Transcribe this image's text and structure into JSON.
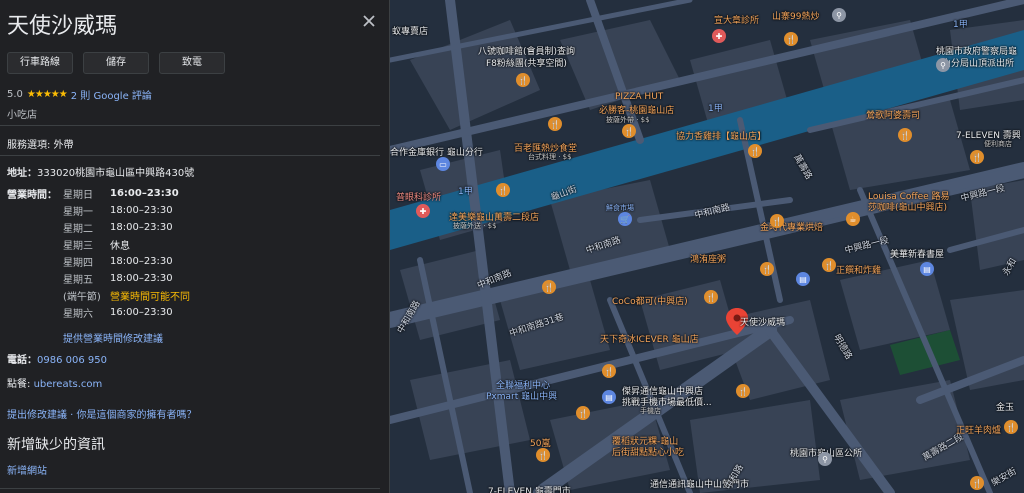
{
  "panel": {
    "title": "天使沙威瑪",
    "buttons": {
      "directions": "行車路線",
      "save": "儲存",
      "call": "致電"
    },
    "rating": {
      "score": "5.0",
      "stars": "★★★★★",
      "reviews": "2 則 Google 評論"
    },
    "category": "小吃店",
    "service_options": "服務選項: 外帶",
    "address_label": "地址：",
    "address": "333020桃園市龜山區中興路430號",
    "hours_label": "營業時間：",
    "hours": [
      {
        "day": "星期日",
        "time": "16:00–23:30"
      },
      {
        "day": "星期一",
        "time": "18:00–23:30"
      },
      {
        "day": "星期二",
        "time": "18:00–23:30"
      },
      {
        "day": "星期三",
        "time": "休息"
      },
      {
        "day": "星期四",
        "time": "18:00–23:30"
      },
      {
        "day": "星期五",
        "time": "18:00–23:30"
      },
      {
        "day": "(端午節)",
        "time": "營業時間可能不同"
      },
      {
        "day": "星期六",
        "time": "16:00–23:30"
      }
    ],
    "suggest_hours": "提供營業時間修改建議",
    "phone_label": "電話：",
    "phone": "0986 006 950",
    "order_label": "點餐:",
    "order": "ubereats.com",
    "suggest_edit": "提出修改建議 · 你是這個商家的擁有者嗎？",
    "missing_info_title": "新增缺少的資訊",
    "add_website": "新增網站"
  },
  "map": {
    "labels": {
      "l1": "蚁專賣店",
      "l2": "八號咖啡館(會員制)查詢",
      "l3": "F8粉絲團(共享空間)",
      "l4": "宣大章診所",
      "l5": "山寨99熱炒",
      "l6": "桃園市政府警察局龜",
      "l7": "山分局山頂派出所",
      "l8": "PIZZA HUT",
      "l9": "必勝客-桃園龜山店",
      "l10": "披薩外帶 · $$",
      "l11": "1甲",
      "l12": "1甲",
      "l13": "1甲",
      "l14": "鶯歌阿婆壽司",
      "l15": "協力香雞排【龜山店】",
      "l16": "合作金庫銀行 龜山分行",
      "l17": "百老匯熱炒食堂",
      "l18": "台式料理 · $$",
      "l19": "7-ELEVEN 壽興",
      "l20": "便利商店",
      "l21": "中興路一段",
      "l22": "普眼科診所",
      "l23": "龜山街",
      "l24": "鮮食市場",
      "l25": "Louisa Coffee 路易",
      "l26": "莎咖啡(龜山中興店)",
      "l27": "達美樂龜山萬壽二段店",
      "l28": "披薩外送 · $$",
      "l29": "中和南路",
      "l30": "金時代專業烘焙",
      "l31": "中興路一段",
      "l32": "中和南路",
      "l33": "鴻洧座粥",
      "l34": "中和南路",
      "l35": "正饌和炸雞",
      "l36": "美華新春書屋",
      "l37": "中和南路",
      "l38": "CoCo都可(中興店)",
      "l39": "天使沙威瑪",
      "l40": "中和南路31巷",
      "l41": "天下奇冰ICEVER 龜山店",
      "l42": "全聯福利中心",
      "l43": "Pxmart 龜山中興",
      "l44": "傑昇通信龜山中興店",
      "l45": "挑戰手機市場最低價...",
      "l46": "手機店",
      "l47": "明德路",
      "l48": "50嵐",
      "l49": "覆稻狀元粿-龜山",
      "l50": "后街甜點點心小吃",
      "l51": "桃園市龜山區公所",
      "l52": "萬壽路二段",
      "l53": "正旺羊肉爐",
      "l54": "金玉",
      "l55": "通信通訊龜山中山營門市",
      "l56": "7-ELEVEN 龜壽門市",
      "l57": "中和路",
      "l58": "永和",
      "l59": "萬壽路",
      "l60": "樂安街"
    }
  }
}
